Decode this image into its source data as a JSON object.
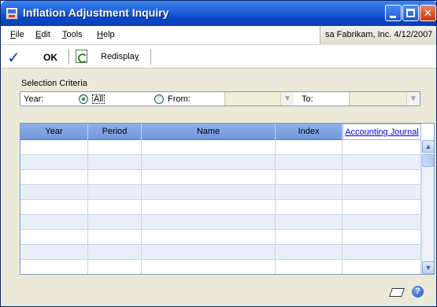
{
  "window": {
    "title": "Inflation Adjustment Inquiry"
  },
  "menu": {
    "file": {
      "hot": "F",
      "rest": "ile"
    },
    "edit": {
      "hot": "E",
      "rest": "dit"
    },
    "tools": {
      "hot": "T",
      "rest": "ools"
    },
    "help": {
      "hot": "H",
      "rest": "elp"
    }
  },
  "user_info": "sa  Fabrikam, Inc.  4/12/2007",
  "toolbar": {
    "ok_label": "OK",
    "redisplay_pre": "Redispla",
    "redisplay_hot": "y"
  },
  "selection": {
    "title": "Selection Criteria",
    "year_label": "Year:",
    "all_label": "All",
    "from_label": "From:",
    "to_label": "To:",
    "selected": "All"
  },
  "table": {
    "columns": [
      "Year",
      "Period",
      "Name",
      "Index",
      "Accounting Journal"
    ],
    "rows": [
      [],
      [],
      [],
      [],
      [],
      [],
      [],
      [],
      []
    ]
  },
  "icons": {
    "title": "window-app-icon",
    "ok": "checkmark-icon",
    "redisplay": "refresh-icon",
    "note": "note-icon",
    "help": "help-icon"
  }
}
